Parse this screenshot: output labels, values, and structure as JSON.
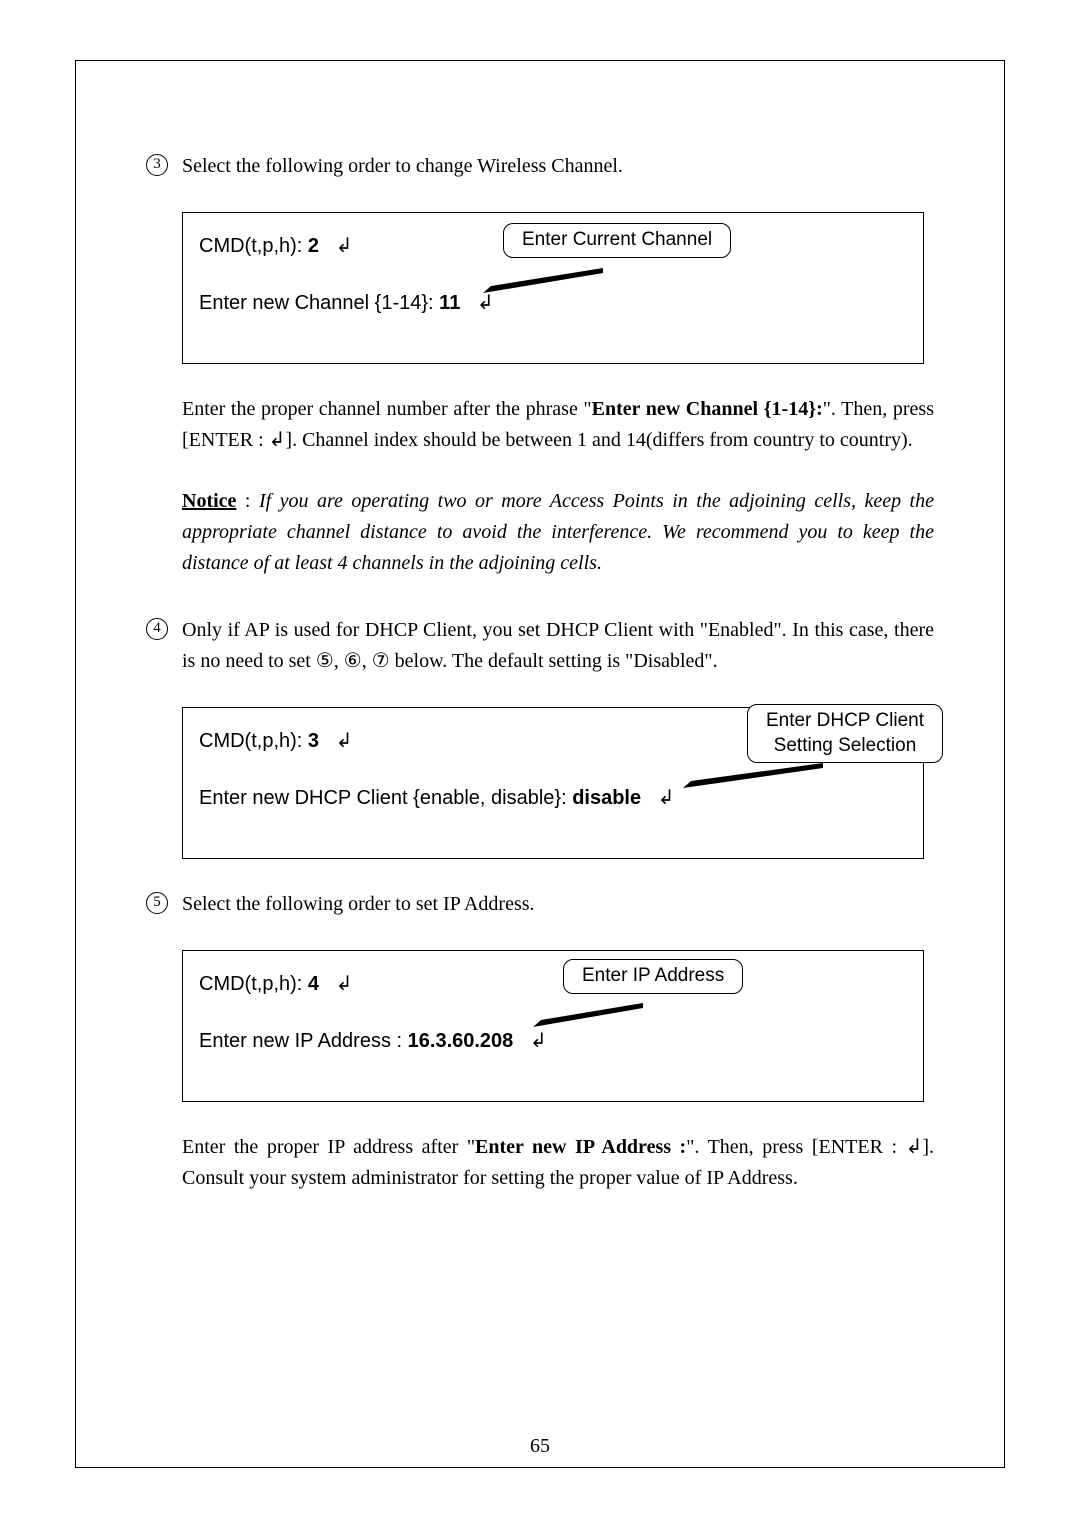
{
  "item3": {
    "marker": "3",
    "text": "Select the following order to change Wireless Channel."
  },
  "box1": {
    "line1_prefix": "CMD(t,p,h): ",
    "line1_value": "2",
    "line2_prefix": "Enter new Channel {1-14}: ",
    "line2_value": "11",
    "callout": "Enter Current Channel"
  },
  "para1": {
    "t1": "Enter the proper channel number after the phrase \"",
    "bold": "Enter new Channel {1-14}:",
    "t2": "\". Then, press [ENTER : ↲]. Channel index should be between 1 and 14(differs from country to country)."
  },
  "notice": {
    "label": "Notice",
    "colon": " : ",
    "text": "If you are operating two or more Access Points in the adjoining cells, keep the appropriate channel distance to avoid the interference. We recommend you to keep the distance of at least 4 channels in the adjoining cells."
  },
  "item4": {
    "marker": "4",
    "text": "Only if AP is used for DHCP Client, you set DHCP Client with \"Enabled\". In this case, there is no need to set ⑤, ⑥, ⑦ below. The default setting is \"Disabled\"."
  },
  "box2": {
    "line1_prefix": "CMD(t,p,h): ",
    "line1_value": "3",
    "line2_prefix": "Enter new DHCP Client {enable, disable}: ",
    "line2_value": "disable",
    "callout_l1": "Enter DHCP Client",
    "callout_l2": "Setting Selection"
  },
  "item5": {
    "marker": "5",
    "text": "Select the following order to set IP Address."
  },
  "box3": {
    "line1_prefix": "CMD(t,p,h): ",
    "line1_value": "4",
    "line2_prefix": "Enter new IP Address : ",
    "line2_value": "16.3.60.208",
    "callout": "Enter IP Address"
  },
  "para2": {
    "t1": "Enter the proper IP address after \"",
    "bold": "Enter new IP Address :",
    "t2": "\". Then, press [ENTER : ↲]. Consult your system administrator for setting the proper value of IP Address."
  },
  "page_number": "65",
  "enter_glyph": "↲"
}
